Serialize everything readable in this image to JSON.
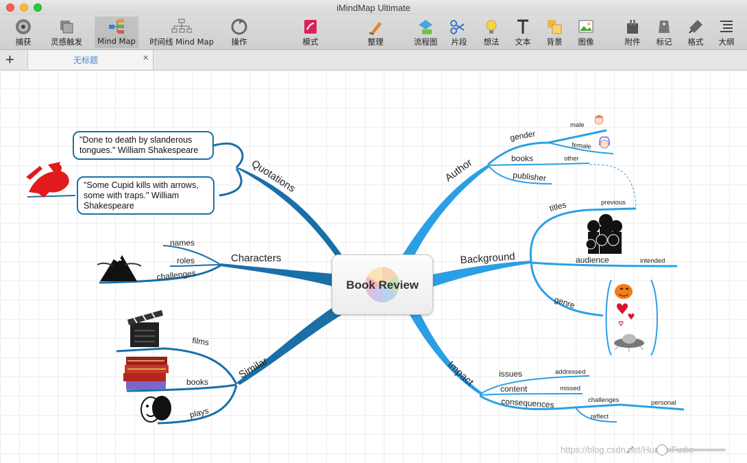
{
  "window": {
    "title": "iMindMap Ultimate"
  },
  "toolbar": {
    "items": [
      {
        "label": "捕获",
        "icon": "capture-icon"
      },
      {
        "label": "灵感触发",
        "icon": "inspiration-icon"
      },
      {
        "label": "Mind Map",
        "icon": "mind-map-icon",
        "selected": true
      },
      {
        "label": "时间线 Mind Map",
        "icon": "timeline-icon"
      },
      {
        "label": "操作",
        "icon": "action-icon"
      },
      {
        "label": "模式",
        "icon": "mode-icon"
      },
      {
        "label": "整理",
        "icon": "tidy-icon"
      },
      {
        "label": "流程图",
        "icon": "flowchart-icon"
      },
      {
        "label": "片段",
        "icon": "snippet-icon"
      },
      {
        "label": "想法",
        "icon": "idea-icon"
      },
      {
        "label": "文本",
        "icon": "text-icon"
      },
      {
        "label": "背景",
        "icon": "background-icon"
      },
      {
        "label": "图像",
        "icon": "image-icon"
      },
      {
        "label": "附件",
        "icon": "attachment-icon"
      },
      {
        "label": "标记",
        "icon": "marker-icon"
      },
      {
        "label": "格式",
        "icon": "format-icon"
      },
      {
        "label": "大纲",
        "icon": "outline-icon"
      }
    ]
  },
  "tabs": {
    "add": "+",
    "current": "无标题",
    "close": "×"
  },
  "map": {
    "center": "Book Review",
    "quotations": {
      "label": "Quotations",
      "quote1": "\"Done to death by slanderous tongues.\" William Shakespeare",
      "quote2": "\"Some Cupid kills with arrows, some with traps.\" William Shakespeare"
    },
    "characters": {
      "label": "Characters",
      "names": "names",
      "roles": "roles",
      "challenges": "challenges"
    },
    "similar": {
      "label": "Similar",
      "films": "films",
      "books": "books",
      "plays": "plays"
    },
    "author": {
      "label": "Author",
      "gender": "gender",
      "male": "male",
      "female": "female",
      "books": "books",
      "other": "other",
      "publisher": "publisher"
    },
    "background": {
      "label": "Background",
      "titles": "titles",
      "previous": "previous",
      "audience": "audience",
      "intended": "intended",
      "genre": "genre"
    },
    "impact": {
      "label": "Impact",
      "issues": "issues",
      "addressed": "addressed",
      "content": "content",
      "missed": "missed",
      "consequences": "consequences",
      "challenges": "challenges",
      "personal": "personal",
      "reflect": "reflect"
    }
  },
  "colors": {
    "left_branch": "#1a6fa8",
    "right_branch": "#2a9fe6"
  },
  "watermark": "https://blog.csdn.net/HuaZeiFudie"
}
